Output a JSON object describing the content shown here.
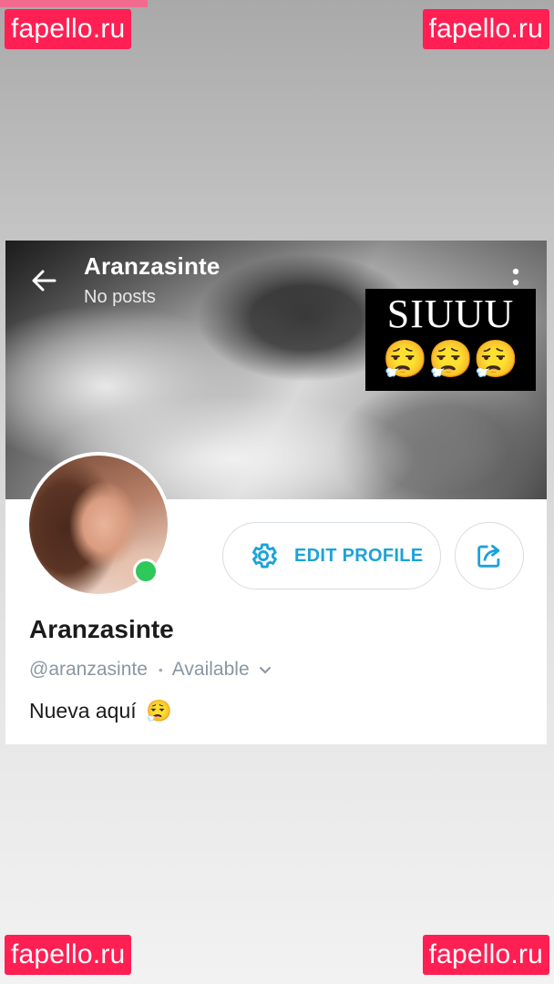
{
  "watermarks": {
    "top_left": "fapello.ru",
    "top_right": "fapello.ru",
    "bottom_left": "fapello.ru",
    "bottom_right": "fapello.ru"
  },
  "header": {
    "title": "Aranzasinte",
    "subtitle": "No posts"
  },
  "cover_sticker": {
    "text": "SIUUU",
    "emojis": "😮‍💨😮‍💨😮‍💨"
  },
  "profile": {
    "name": "Aranzasinte",
    "handle": "@aranzasinte",
    "separator": "•",
    "status": "Available",
    "bio": "Nueva aquí",
    "bio_emoji": "😮‍💨",
    "online": true
  },
  "actions": {
    "edit_profile_label": "EDIT PROFILE"
  },
  "colors": {
    "accent": "#1aa3d8",
    "online": "#2fc85a",
    "watermark": "#ff1f53"
  },
  "icons": [
    "back-arrow-icon",
    "more-vertical-icon",
    "gear-icon",
    "share-icon",
    "chevron-down-icon"
  ]
}
